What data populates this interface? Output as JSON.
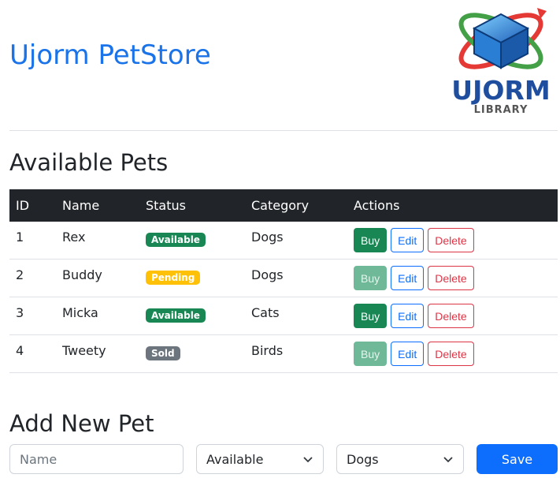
{
  "app": {
    "title": "Ujorm PetStore",
    "logo": {
      "text_main": "UJORM",
      "text_sub": "LIBRARY"
    }
  },
  "pets_section": {
    "title": "Available Pets",
    "columns": [
      "ID",
      "Name",
      "Status",
      "Category",
      "Actions"
    ],
    "rows": [
      {
        "id": "1",
        "name": "Rex",
        "status": "Available",
        "category": "Dogs",
        "buy_enabled": true
      },
      {
        "id": "2",
        "name": "Buddy",
        "status": "Pending",
        "category": "Dogs",
        "buy_enabled": false
      },
      {
        "id": "3",
        "name": "Micka",
        "status": "Available",
        "category": "Cats",
        "buy_enabled": true
      },
      {
        "id": "4",
        "name": "Tweety",
        "status": "Sold",
        "category": "Birds",
        "buy_enabled": false
      }
    ],
    "actions": {
      "buy": "Buy",
      "edit": "Edit",
      "delete": "Delete"
    }
  },
  "add_section": {
    "title": "Add New Pet",
    "name_placeholder": "Name",
    "status_value": "Available",
    "category_value": "Dogs",
    "save_label": "Save"
  },
  "colors": {
    "brand": "#1a73e8",
    "available": "#198754",
    "pending": "#ffc107",
    "sold": "#6c757d",
    "primary": "#0d6efd",
    "danger": "#dc3545"
  }
}
